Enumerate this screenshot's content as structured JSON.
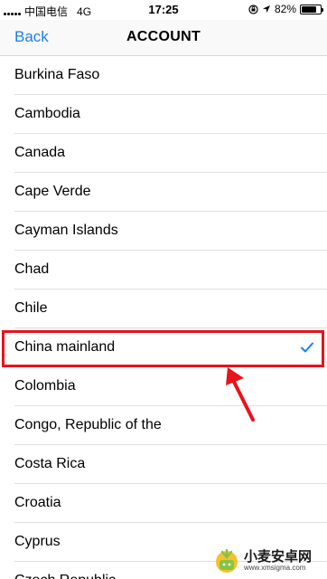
{
  "status_bar": {
    "carrier": "中国电信",
    "network": "4G",
    "time": "17:25",
    "battery": "82%",
    "battery_level": 0.82,
    "icons": [
      "signal-icon",
      "lock-rotation-icon",
      "location-icon",
      "battery-icon"
    ]
  },
  "nav": {
    "back_label": "Back",
    "title": "ACCOUNT"
  },
  "countries": [
    {
      "label": "Burkina Faso",
      "selected": false
    },
    {
      "label": "Cambodia",
      "selected": false
    },
    {
      "label": "Canada",
      "selected": false
    },
    {
      "label": "Cape Verde",
      "selected": false
    },
    {
      "label": "Cayman Islands",
      "selected": false
    },
    {
      "label": "Chad",
      "selected": false
    },
    {
      "label": "Chile",
      "selected": false
    },
    {
      "label": "China mainland",
      "selected": true
    },
    {
      "label": "Colombia",
      "selected": false
    },
    {
      "label": "Congo, Republic of the",
      "selected": false
    },
    {
      "label": "Costa Rica",
      "selected": false
    },
    {
      "label": "Croatia",
      "selected": false
    },
    {
      "label": "Cyprus",
      "selected": false
    },
    {
      "label": "Czech Republic",
      "selected": false
    }
  ],
  "colors": {
    "accent": "#1d80e6",
    "highlight": "#e8131b"
  },
  "watermark": {
    "title": "小麦安卓网",
    "url": "www.xmsigma.com"
  }
}
